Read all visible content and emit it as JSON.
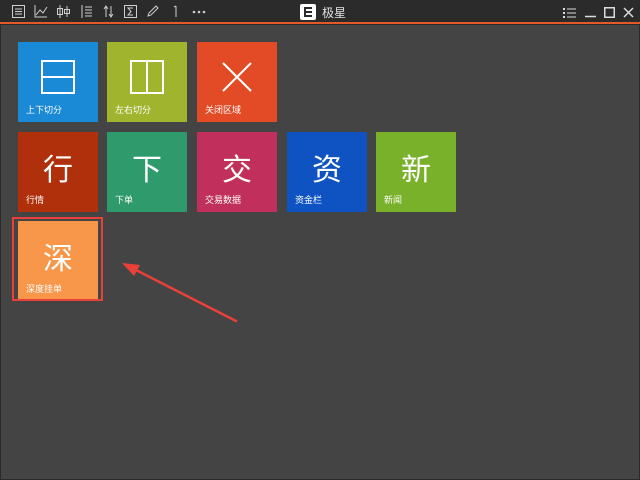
{
  "app": {
    "title": "极星",
    "logo_icon": "app-logo-icon",
    "accent_color": "#e35a2a"
  },
  "toolbar": {
    "icons": [
      "quote-list-icon",
      "line-chart-icon",
      "candlestick-icon",
      "panel-split-icon",
      "sort-icon",
      "formula-icon",
      "pencil-icon",
      "cursor-line-icon",
      "more-icon"
    ]
  },
  "window_controls": {
    "icons": [
      "menu-icon",
      "minimize-icon",
      "maximize-icon",
      "close-icon"
    ]
  },
  "tiles": [
    {
      "label": "上下切分",
      "glyph": "",
      "icon": "split-horizontal-icon",
      "color": "#1b8ad6"
    },
    {
      "label": "左右切分",
      "glyph": "",
      "icon": "split-vertical-icon",
      "color": "#a0b42e"
    },
    {
      "label": "关闭区域",
      "glyph": "",
      "icon": "close-area-icon",
      "color": "#e24b26"
    },
    {
      "label": "行情",
      "glyph": "行",
      "icon": "",
      "color": "#b0300b"
    },
    {
      "label": "下单",
      "glyph": "下",
      "icon": "",
      "color": "#2f9a6c"
    },
    {
      "label": "交易数据",
      "glyph": "交",
      "icon": "",
      "color": "#c1305c"
    },
    {
      "label": "资金栏",
      "glyph": "资",
      "icon": "",
      "color": "#0f53c2"
    },
    {
      "label": "新闻",
      "glyph": "新",
      "icon": "",
      "color": "#79b12a"
    },
    {
      "label": "深度挂单",
      "glyph": "深",
      "icon": "",
      "color": "#f8964a"
    }
  ],
  "annotation": {
    "highlight_color": "#e8413a",
    "arrow_icon": "annotation-arrow-icon"
  }
}
